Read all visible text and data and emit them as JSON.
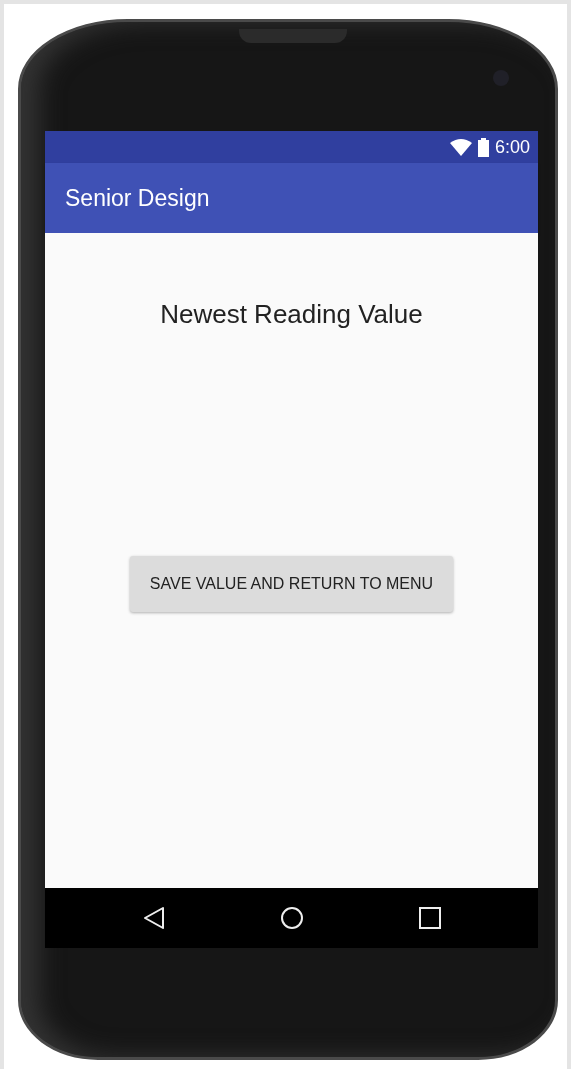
{
  "status_bar": {
    "time": "6:00"
  },
  "app_bar": {
    "title": "Senior Design"
  },
  "content": {
    "heading": "Newest Reading Value",
    "button": {
      "label": "SAVE VALUE AND RETURN TO MENU"
    }
  }
}
